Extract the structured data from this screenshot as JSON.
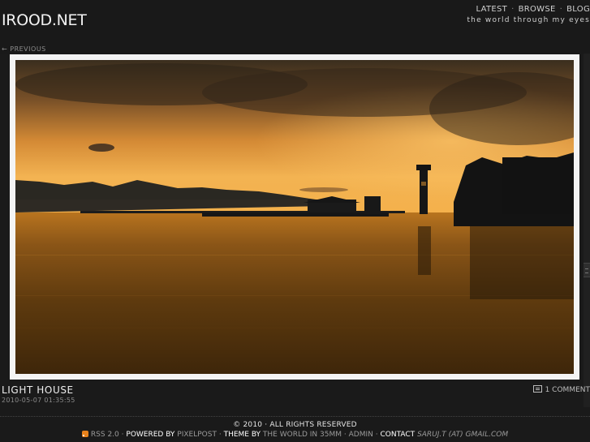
{
  "site": {
    "title": "IROOD.NET",
    "tagline": "the world through my eyes"
  },
  "nav": {
    "latest": "LATEST",
    "browse": "BROWSE",
    "blog": "BLOG"
  },
  "prev_link": "← PREVIOUS",
  "photo": {
    "title": "LIGHT HOUSE",
    "date": "2010-05-07 01:35:55",
    "comments": "1 COMMENT",
    "colors": {
      "sky_top": "#3a2e1e",
      "sky_glow": "#f0a640",
      "water": "#6a4210",
      "silhouette": "#141414"
    }
  },
  "footer": {
    "copyright": "© 2010 · ALL RIGHTS RESERVED",
    "rss": "RSS 2.0",
    "sep": "·",
    "powered_by_label": "POWERED BY",
    "powered_by_value": "PIXELPOST",
    "theme_label": "THEME BY",
    "theme_value": "THE WORLD IN 35MM",
    "admin": "ADMIN",
    "contact_label": "CONTACT",
    "contact_value": "SARUJ.T (AT) GMAIL.COM"
  }
}
